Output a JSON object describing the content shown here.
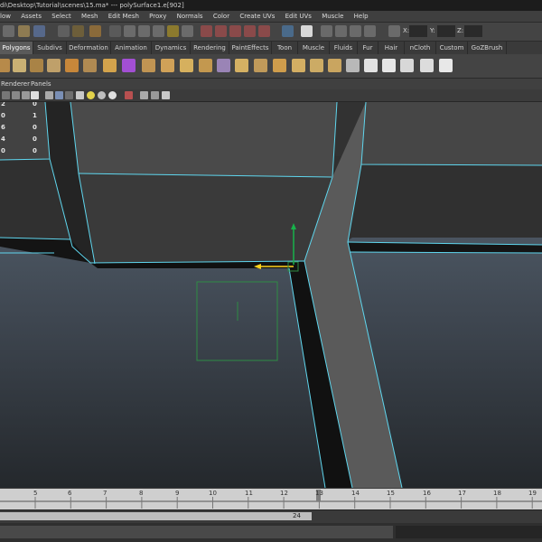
{
  "window": {
    "title": "di\\Desktop\\Tutorial\\scenes\\15.ma*   ---   polySurface1.e[902]"
  },
  "menu": {
    "items": [
      "low",
      "Assets",
      "Select",
      "Mesh",
      "Edit Mesh",
      "Proxy",
      "Normals",
      "Color",
      "Create UVs",
      "Edit UVs",
      "Muscle",
      "Help"
    ]
  },
  "status_line": {
    "x_label": "X:",
    "y_label": "Y:",
    "z_label": "Z:"
  },
  "shelf_tabs": {
    "items": [
      "Polygons",
      "Subdivs",
      "Deformation",
      "Animation",
      "Dynamics",
      "Rendering",
      "PaintEffects",
      "Toon",
      "Muscle",
      "Fluids",
      "Fur",
      "Hair",
      "nCloth",
      "Custom",
      "GoZBrush"
    ],
    "active": "Polygons"
  },
  "panel_menu": {
    "items": [
      "Renderer",
      "Panels"
    ]
  },
  "hud": {
    "rows": [
      {
        "left": "2",
        "right": "0"
      },
      {
        "left": "0",
        "right": "1"
      },
      {
        "left": "6",
        "right": "0"
      },
      {
        "left": "4",
        "right": "0"
      },
      {
        "left": "0",
        "right": "0"
      }
    ]
  },
  "timeline": {
    "ticks": [
      "5",
      "6",
      "7",
      "8",
      "9",
      "10",
      "11",
      "12",
      "13",
      "14",
      "15",
      "16",
      "17",
      "18",
      "19"
    ]
  },
  "range": {
    "end_frame": "24"
  },
  "colors": {
    "edge_highlight": "#5fd6ee",
    "grid_green": "#2e8c44",
    "manip_y": "#17b24a",
    "manip_x": "#ffd21c"
  }
}
